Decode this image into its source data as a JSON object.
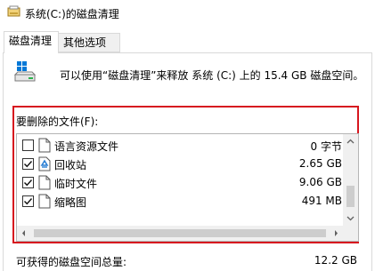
{
  "window": {
    "title": "系统(C:)的磁盘清理"
  },
  "tabs": [
    {
      "label": "磁盘清理",
      "selected": true
    },
    {
      "label": "其他选项",
      "selected": false
    }
  ],
  "info": {
    "text": "可以使用“磁盘清理”来释放 系统 (C:) 上的 15.4 GB 磁盘空间。"
  },
  "files": {
    "label": "要删除的文件(F):",
    "items": [
      {
        "name": "语言资源文件",
        "size": "0 字节",
        "checked": false,
        "icon": "document-icon"
      },
      {
        "name": "回收站",
        "size": "2.65 GB",
        "checked": true,
        "icon": "recycle-bin-icon"
      },
      {
        "name": "临时文件",
        "size": "9.06 GB",
        "checked": true,
        "icon": "document-icon"
      },
      {
        "name": "缩略图",
        "size": "491 MB",
        "checked": true,
        "icon": "document-icon"
      }
    ]
  },
  "total": {
    "label": "可获得的磁盘空间总量:",
    "value": "12.2 GB"
  },
  "colors": {
    "highlight_border": "#d7171f",
    "window_accent": "#0078d7"
  }
}
